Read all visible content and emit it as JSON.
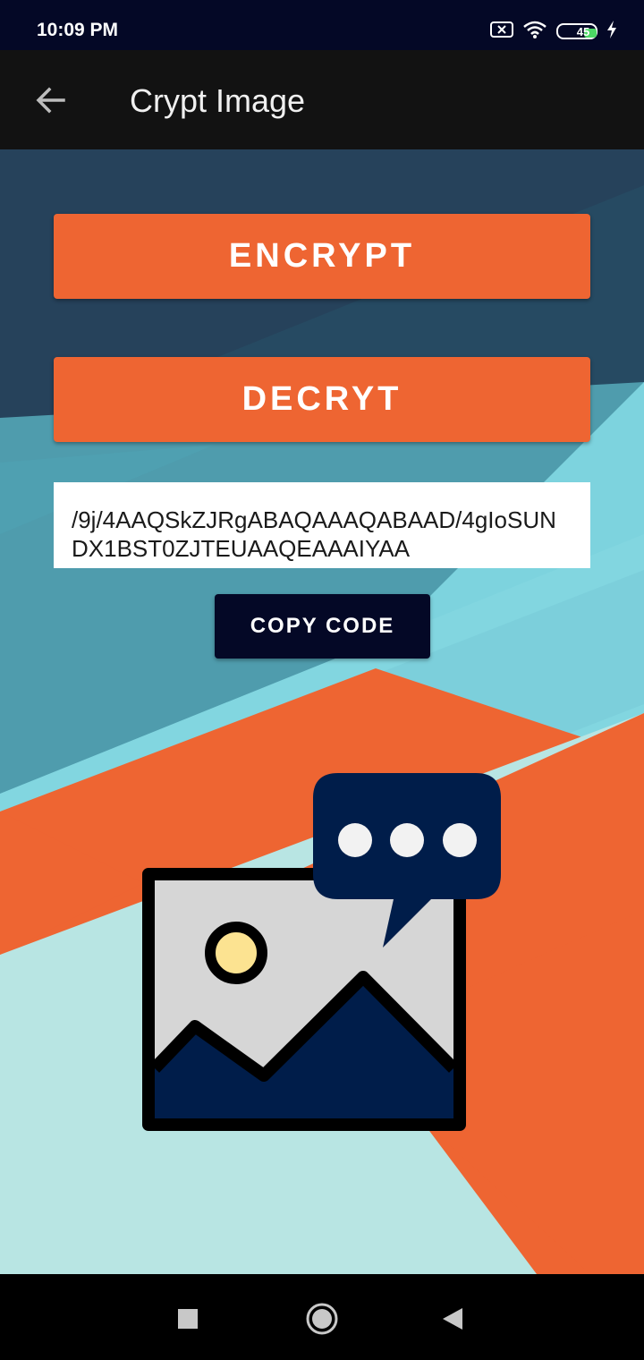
{
  "status_bar": {
    "time": "10:09 PM",
    "battery_level": "45",
    "icons": [
      "sim-x-icon",
      "wifi-icon",
      "battery-icon",
      "charging-bolt-icon"
    ]
  },
  "app_bar": {
    "title": "Crypt Image",
    "back_icon": "arrow-back-icon"
  },
  "actions": {
    "encrypt_label": "ENCRYPT",
    "decrypt_label": "DECRYT",
    "copy_label": "COPY CODE"
  },
  "code_output": {
    "value": "/9j/4AAQSkZJRgABAQAAAQABAAD/4gIoSUNDX1BST0ZJTEUAAQEAAAIYAA"
  },
  "illustration": {
    "icon": "image-message-icon"
  },
  "nav_bar": {
    "icons": [
      "recents-square-icon",
      "home-circle-icon",
      "back-triangle-icon"
    ]
  },
  "colors": {
    "accent_orange": "#EE6532",
    "navy": "#040826",
    "illustration_navy": "#001D4A"
  }
}
